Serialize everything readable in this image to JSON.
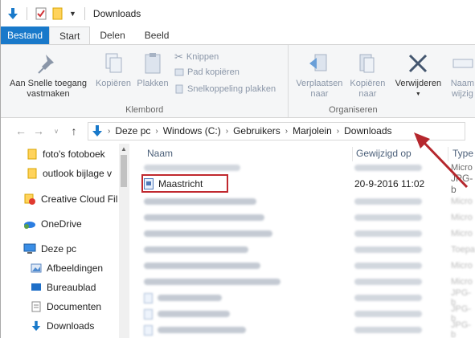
{
  "window": {
    "title": "Downloads"
  },
  "ribbon_tabs": [
    {
      "label": "Bestand"
    },
    {
      "label": "Start"
    },
    {
      "label": "Delen"
    },
    {
      "label": "Beeld"
    }
  ],
  "ribbon": {
    "pin": {
      "line1": "Aan Snelle toegang",
      "line2": "vastmaken"
    },
    "copy": "Kopiëren",
    "paste": "Plakken",
    "cut": "Knippen",
    "copy_path": "Pad kopiëren",
    "paste_shortcut": "Snelkoppeling plakken",
    "clipboard_group": "Klembord",
    "move_to": {
      "line1": "Verplaatsen",
      "line2": "naar"
    },
    "copy_to": {
      "line1": "Kopiëren",
      "line2": "naar"
    },
    "delete": "Verwijderen",
    "rename": {
      "line1": "Naam",
      "line2": "wijzig"
    },
    "organize_group": "Organiseren"
  },
  "breadcrumb": [
    "Deze pc",
    "Windows (C:)",
    "Gebruikers",
    "Marjolein",
    "Downloads"
  ],
  "nav_pane": [
    {
      "label": "foto's fotoboek",
      "icon": "folder-icon"
    },
    {
      "label": "outlook bijlage v",
      "icon": "folder-icon"
    },
    {
      "label": "Creative Cloud Fil",
      "icon": "creative-cloud-icon"
    },
    {
      "label": "OneDrive",
      "icon": "cloud-icon"
    },
    {
      "label": "Deze pc",
      "icon": "computer-icon"
    },
    {
      "label": "Afbeeldingen",
      "icon": "pictures-icon"
    },
    {
      "label": "Bureaublad",
      "icon": "desktop-icon"
    },
    {
      "label": "Documenten",
      "icon": "documents-icon"
    },
    {
      "label": "Downloads",
      "icon": "downloads-icon"
    }
  ],
  "columns": {
    "name": "Naam",
    "modified": "Gewijzigd op",
    "type": "Type"
  },
  "files": {
    "visible_row": {
      "name": "Maastricht",
      "modified": "20-9-2016 11:02",
      "type": "JPG-b"
    },
    "partial_type_top": "Micro",
    "type_partials": [
      "Micro",
      "Micro",
      "Micro",
      "Micro",
      "Toepa",
      "Micro",
      "Micro",
      "JPG-b",
      "JPG-b",
      "JPG-b"
    ]
  },
  "colors": {
    "file_tab": "#1979ca",
    "highlight": "#c0282e",
    "annotation_arrow": "#b5272d",
    "accent_blue": "#1979ca"
  }
}
